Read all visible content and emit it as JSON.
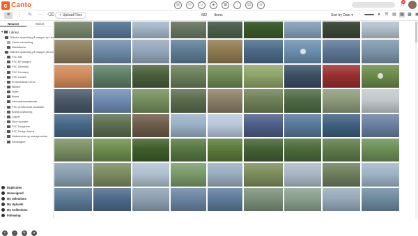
{
  "app": {
    "logo_mark": "c",
    "logo_text": "Canto"
  },
  "topbar": {
    "icons": [
      "library-icon",
      "clock-icon",
      "people-icon",
      "tag-icon",
      "grid-icon",
      "upload-icon",
      "chart-icon",
      "portal-icon"
    ],
    "notification_count": "28"
  },
  "toolbar": {
    "upload_label": "Upload Files",
    "count": "682",
    "count_label": "Items",
    "sort_label": "Sort by Date"
  },
  "sidebar": {
    "tabs": [
      "Newest",
      "Oldest"
    ],
    "root": "Library",
    "items": [
      "Billeder opsamling på mapper by Lisa Kaiser",
      "Canto onboarding",
      "Illustrationer",
      "Billeder opsamling på mapper på Vee 111",
      "FSC Alle",
      "FSC AR Images",
      "FSC Danmark",
      "FSC Germany",
      "FSC Landen",
      "Pressebilleder 2014",
      "Billeder",
      "Noter",
      "Brand",
      "Informationsmateriale",
      "FSC certificerede produkter",
      "Brand positioning",
      "Logoer",
      "Skov og natur",
      "FSC Designere",
      "FSC Design Award",
      "Uddannelse og arrangementer",
      "Kampagner"
    ],
    "sections": [
      "Duplicates",
      "Unassigned",
      "My Selections",
      "My Uploads",
      "My Collections",
      "Following"
    ]
  },
  "grid": {
    "column_widths": [
      56,
      56,
      55,
      53,
      52,
      58,
      55,
      56,
      56
    ],
    "rows": [
      [
        "#7a8a6e",
        "#5b7a9a",
        "#a9bccd",
        "#6d7a66",
        "#4f6350",
        "#3d5d2e",
        "#8aa3bb",
        "#3f4a3a",
        "#b8c6d2"
      ],
      [
        "#8d7d5e",
        "#6e8aa8",
        "#94a7bb",
        "#5e7c94",
        "#8e7a50",
        "#4b6a88",
        "#6b8fae",
        "#5d7593",
        "#7d95a9"
      ],
      [
        "#d08a5a",
        "#5d7f66",
        "#4a5e3a",
        "#6a7d59",
        "#6f8a54",
        "#8ea46a",
        "#3c4f64",
        "#9a2f2f",
        "#6b8a4b"
      ],
      [
        "#4a5868",
        "#6f8bb0",
        "#758d5c",
        "#5a6b4d",
        "#8a7e66",
        "#6e8057",
        "#4e6a44",
        "#8c9a7a",
        "#c2c9cc"
      ],
      [
        "#486788",
        "#5c6e4e",
        "#6e5b4a",
        "#9ab0c6",
        "#b8c8d8",
        "#4d5d88",
        "#58779a",
        "#3f5f80",
        "#6a7fa1"
      ],
      [
        "#7a8e64",
        "#6d8d4d",
        "#3f5d2a",
        "#577742",
        "#5a7a3a",
        "#436034",
        "#4a6b3a",
        "#5f7a4a",
        "#6b8f58"
      ],
      [
        "#8aa0b0",
        "#7a8a60",
        "#b0c0d0",
        "#7a9a6a",
        "#9aacc0",
        "#7c8d5c",
        "#aab8c4",
        "#6d7e5e",
        "#a0b4c6"
      ],
      [
        "#5b7a96",
        "#4d6a8a",
        "#8ea0b0",
        "#6a84a0",
        "#5d7b99",
        "#7b8f7a",
        "#8a9f8d",
        "#97aab9",
        "#6f8ba0"
      ]
    ],
    "play_cells": [
      [
        1,
        6
      ],
      [
        2,
        8
      ]
    ]
  }
}
